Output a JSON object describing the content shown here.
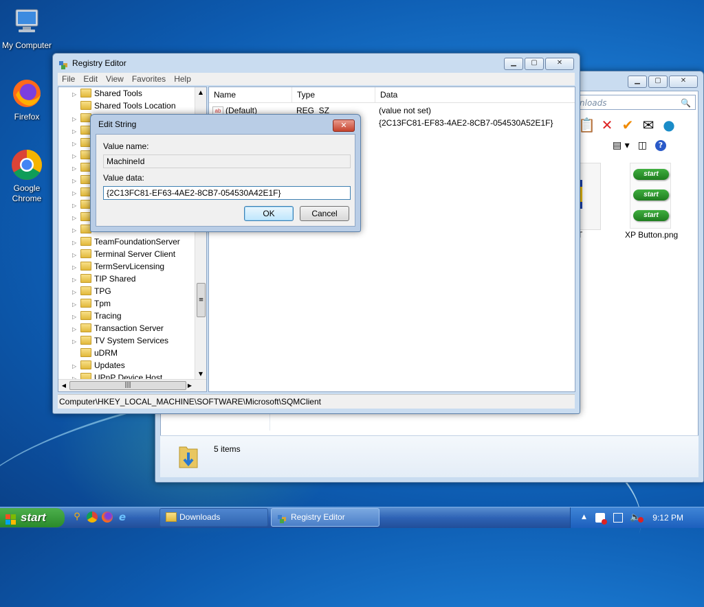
{
  "desktop": {
    "icons": [
      {
        "label": "My Computer"
      },
      {
        "label": "Firefox"
      },
      {
        "label": "Google Chrome"
      }
    ]
  },
  "explorer": {
    "search_placeholder": "nloads",
    "files": [
      {
        "label": "BT"
      },
      {
        "label": "XP Button.png"
      }
    ],
    "xp_button_text": "start",
    "status": "5 items"
  },
  "regedit": {
    "title": "Registry Editor",
    "menu": [
      "File",
      "Edit",
      "View",
      "Favorites",
      "Help"
    ],
    "tree": [
      "Shared Tools",
      "Shared Tools Location",
      "TeamFoundationServer",
      "Terminal Server Client",
      "TermServLicensing",
      "TIP Shared",
      "TPG",
      "Tpm",
      "Tracing",
      "Transaction Server",
      "TV System Services",
      "uDRM",
      "Updates",
      "UPnP Device Host"
    ],
    "columns": [
      "Name",
      "Type",
      "Data"
    ],
    "rows": [
      {
        "name": "(Default)",
        "type": "REG_SZ",
        "data": "(value not set)"
      },
      {
        "name": "",
        "type": "",
        "data": "{2C13FC81-EF83-4AE2-8CB7-054530A52E1F}"
      }
    ],
    "status_path": "Computer\\HKEY_LOCAL_MACHINE\\SOFTWARE\\Microsoft\\SQMClient"
  },
  "dialog": {
    "title": "Edit String",
    "value_name_label": "Value name:",
    "value_name": "MachineId",
    "value_data_label": "Value data:",
    "value_data": "{2C13FC81-EF63-4AE2-8CB7-054530A42E1F}",
    "ok": "OK",
    "cancel": "Cancel"
  },
  "taskbar": {
    "start": "start",
    "tasks": [
      {
        "label": "Downloads"
      },
      {
        "label": "Registry Editor"
      }
    ],
    "time": "9:12 PM"
  },
  "colors": {
    "accent": "#1a78cf",
    "start_green": "#2a8a2a"
  }
}
